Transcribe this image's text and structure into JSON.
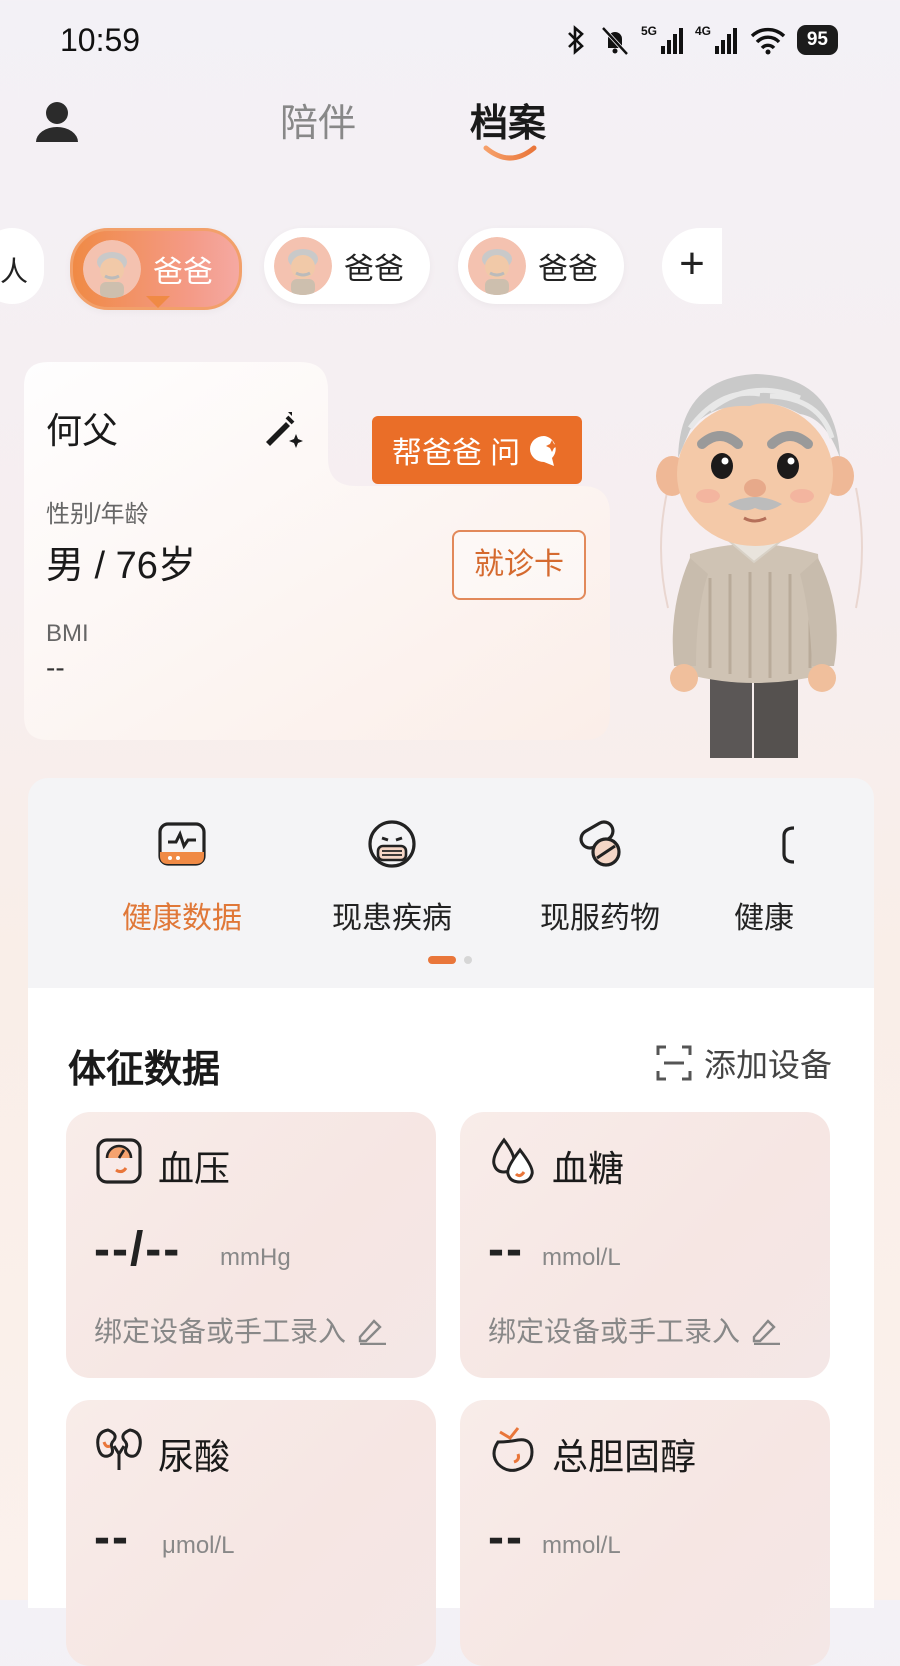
{
  "status_bar": {
    "time": "10:59",
    "network_5g": "5G",
    "network_4g": "4G",
    "battery": "95"
  },
  "header": {
    "tabs": [
      {
        "label": "陪伴",
        "active": false
      },
      {
        "label": "档案",
        "active": true
      }
    ],
    "accent_color": "#E9763A"
  },
  "family": {
    "partial_left_label": "人",
    "members": [
      {
        "label": "爸爸",
        "active": true
      },
      {
        "label": "爸爸",
        "active": false
      },
      {
        "label": "爸爸",
        "active": false
      }
    ],
    "add_label": "+"
  },
  "profile": {
    "name": "何父",
    "ask_button": "帮爸爸 问",
    "gender_age_label": "性别/年龄",
    "gender_age_value": "男 / 76岁",
    "visit_card_button": "就诊卡",
    "bmi_label": "BMI",
    "bmi_value": "--"
  },
  "quick_nav": {
    "items": [
      {
        "label": "健康数据",
        "icon": "monitor-icon",
        "active": true
      },
      {
        "label": "现患疾病",
        "icon": "masked-face-icon",
        "active": false
      },
      {
        "label": "现服药物",
        "icon": "pill-icon",
        "active": false
      },
      {
        "label": "健康",
        "icon": "partial-icon",
        "active": false
      }
    ],
    "page": 1,
    "pages": 2
  },
  "vitals": {
    "title": "体征数据",
    "add_device": "添加设备",
    "metrics": [
      {
        "name": "血压",
        "value": "--/--",
        "unit": "mmHg",
        "hint": "绑定设备或手工录入",
        "icon": "blood-pressure-icon"
      },
      {
        "name": "血糖",
        "value": "--",
        "unit": "mmol/L",
        "hint": "绑定设备或手工录入",
        "icon": "blood-drop-icon"
      },
      {
        "name": "尿酸",
        "value": "--",
        "unit": "μmol/L",
        "icon": "kidney-icon"
      },
      {
        "name": "总胆固醇",
        "value": "--",
        "unit": "mmol/L",
        "icon": "peach-icon"
      }
    ]
  }
}
